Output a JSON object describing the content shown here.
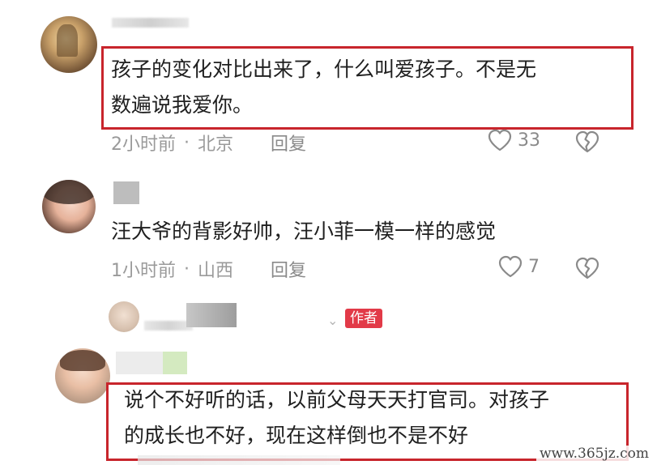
{
  "comments": [
    {
      "text": "孩子的变化对比出来了，什么叫爱孩子。不是无\n数遍说我爱你。",
      "time": "2小时前",
      "location": "北京",
      "reply_label": "回复",
      "likes": "33",
      "highlighted": true
    },
    {
      "text": "汪大爷的背影好帅，汪小菲一模一样的感觉",
      "time": "1小时前",
      "location": "山西",
      "reply_label": "回复",
      "likes": "7",
      "highlighted": false
    },
    {
      "author_badge": "作者"
    },
    {
      "text": "说个不好听的话，以前父母天天打官司。对孩子\n的成长也不好，现在这样倒也不是不好",
      "highlighted": true
    }
  ],
  "separator": "·",
  "watermark": "www.365jz.com",
  "colors": {
    "highlight_border": "#c8252c",
    "author_badge": "#e23a48",
    "meta_text": "#9a9a9a"
  },
  "icons": {
    "like": "heart-icon",
    "dislike": "broken-heart-icon",
    "expand": "chevron-down-icon"
  }
}
